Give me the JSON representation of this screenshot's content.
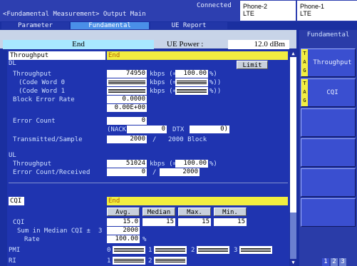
{
  "header": {
    "title": "<Fundamental Measurement> Output Main",
    "connection": "Connected",
    "phone2": {
      "name": "Phone-2",
      "tech": "LTE"
    },
    "phone1": {
      "name": "Phone-1",
      "tech": "LTE"
    }
  },
  "tabs": [
    {
      "label": "Parameter",
      "active": false
    },
    {
      "label": "Fundamental",
      "active": true
    },
    {
      "label": "UE Report",
      "active": false
    }
  ],
  "status": {
    "state": "End",
    "ue_power_label": "UE Power :",
    "ue_power_value": "12.0 dBm"
  },
  "throughput_section": {
    "header": "Throughput",
    "state": "End",
    "limit_button": "Limit",
    "dl": {
      "label": "DL",
      "throughput_label": "Throughput",
      "throughput_value": "74950",
      "unit_kbps": "kbps (=",
      "percent_value": "100.00",
      "percent_unit": "%)",
      "cw0_label": "(Code Word 0",
      "cw1_label": "(Code Word 1",
      "cw_suffix": "%))",
      "bler_label": "Block Error Rate",
      "bler_value": "0.0000",
      "bler_exp_value": "0.00E+00",
      "error_count_label": "Error Count",
      "error_count_value": "0",
      "nack_label": "(NACK",
      "nack_value": "0",
      "dtx_label": "DTX",
      "dtx_value": "0)",
      "transmitted_label": "Transmitted/Sample",
      "transmitted_value": "2000",
      "sample_sep": "/",
      "sample_text": "2000 Block"
    },
    "ul": {
      "label": "UL",
      "throughput_label": "Throughput",
      "throughput_value": "51024",
      "unit_kbps": "kbps (=",
      "percent_value": "100.00",
      "percent_unit": "%)",
      "error_label": "Error Count/Received",
      "error_value": "0",
      "sep": "/",
      "received_value": "2000"
    }
  },
  "cqi_section": {
    "header": "CQI",
    "state": "End",
    "columns": [
      "Avg.",
      "Median",
      "Max.",
      "Min."
    ],
    "cqi_label": "CQI",
    "cqi_values": [
      "15.0",
      "15",
      "15",
      "15"
    ],
    "sum_label": "Sum in Median CQI ±",
    "sum_n": "3",
    "sum_value": "2000",
    "rate_label": "Rate",
    "rate_value": "100.00",
    "rate_unit": "%",
    "pmi_label": "PMI",
    "pmi_indices": [
      "0",
      "1",
      "2",
      "3"
    ],
    "ri_label": "RI",
    "ri_indices": [
      "1",
      "2"
    ]
  },
  "right_panel": {
    "title": "Fundamental",
    "keys": [
      {
        "tag": "T A G",
        "label": "Throughput"
      },
      {
        "tag": "T A G",
        "label": "CQI"
      },
      {
        "tag": "",
        "label": ""
      },
      {
        "tag": "",
        "label": ""
      },
      {
        "tag": "",
        "label": ""
      },
      {
        "tag": "",
        "label": ""
      }
    ],
    "pages": [
      "1",
      "2",
      "3"
    ]
  },
  "colors": {
    "background": "#1a2fa0",
    "state_bar": "#f2ee40",
    "state_text": "#b06000",
    "status_cell": "#a8e8ff"
  }
}
